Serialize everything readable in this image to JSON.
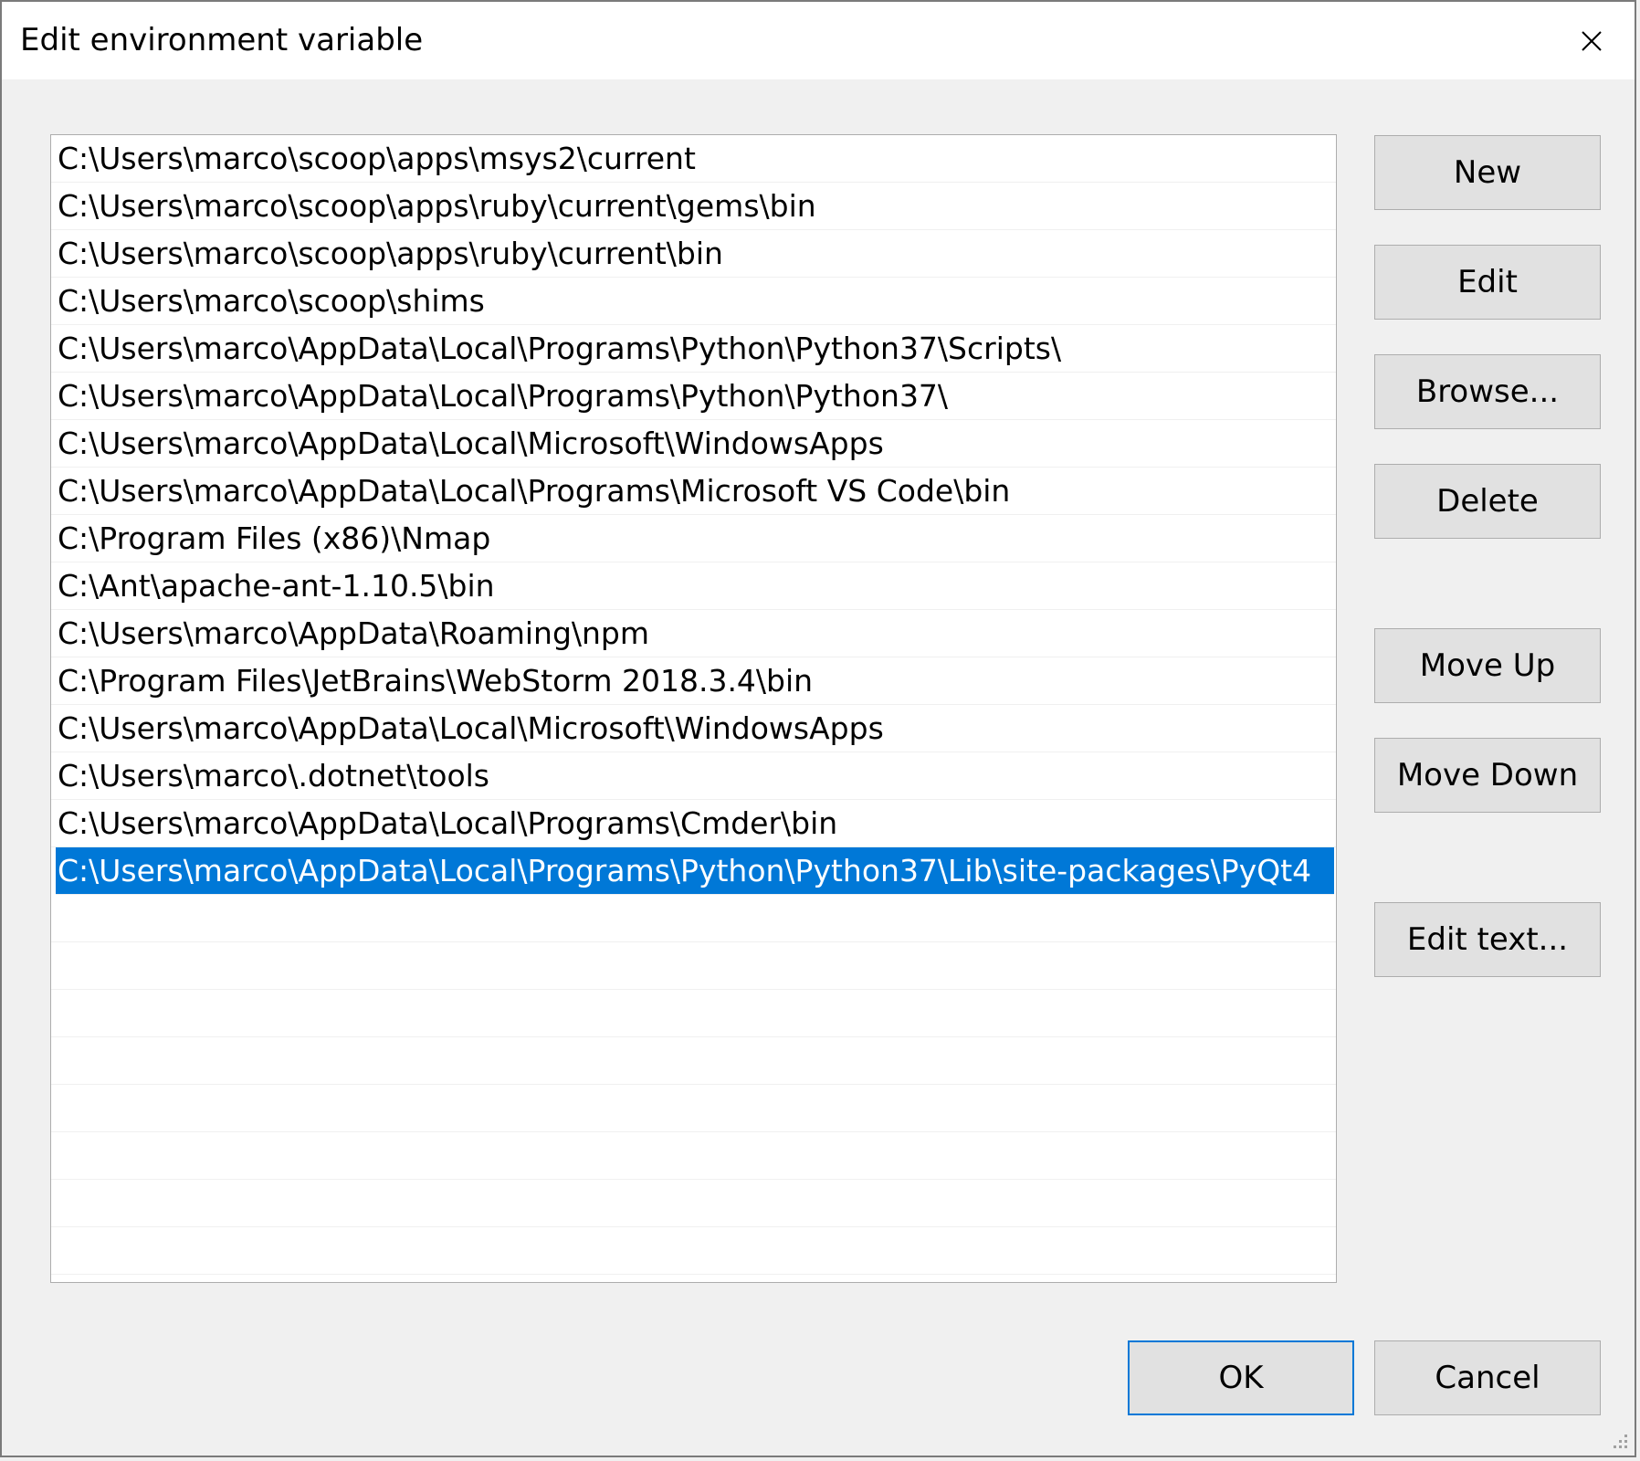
{
  "window": {
    "title": "Edit environment variable"
  },
  "path_list": {
    "items": [
      "C:\\Users\\marco\\scoop\\apps\\msys2\\current",
      "C:\\Users\\marco\\scoop\\apps\\ruby\\current\\gems\\bin",
      "C:\\Users\\marco\\scoop\\apps\\ruby\\current\\bin",
      "C:\\Users\\marco\\scoop\\shims",
      "C:\\Users\\marco\\AppData\\Local\\Programs\\Python\\Python37\\Scripts\\",
      "C:\\Users\\marco\\AppData\\Local\\Programs\\Python\\Python37\\",
      "C:\\Users\\marco\\AppData\\Local\\Microsoft\\WindowsApps",
      "C:\\Users\\marco\\AppData\\Local\\Programs\\Microsoft VS Code\\bin",
      "C:\\Program Files (x86)\\Nmap",
      "C:\\Ant\\apache-ant-1.10.5\\bin",
      "C:\\Users\\marco\\AppData\\Roaming\\npm",
      "C:\\Program Files\\JetBrains\\WebStorm 2018.3.4\\bin",
      "C:\\Users\\marco\\AppData\\Local\\Microsoft\\WindowsApps",
      "C:\\Users\\marco\\.dotnet\\tools",
      "C:\\Users\\marco\\AppData\\Local\\Programs\\Cmder\\bin",
      "C:\\Users\\marco\\AppData\\Local\\Programs\\Python\\Python37\\Lib\\site-packages\\PyQt4"
    ],
    "selected_index": 15
  },
  "buttons": {
    "new": "New",
    "edit": "Edit",
    "browse": "Browse...",
    "delete": "Delete",
    "move_up": "Move Up",
    "move_down": "Move Down",
    "edit_text": "Edit text...",
    "ok": "OK",
    "cancel": "Cancel"
  },
  "icons": {
    "close": "close-icon",
    "resize": "resize-grip-icon"
  },
  "colors": {
    "selection": "#0078d7",
    "button_face": "#e1e1e1",
    "dialog_bg": "#f0f0f0"
  }
}
